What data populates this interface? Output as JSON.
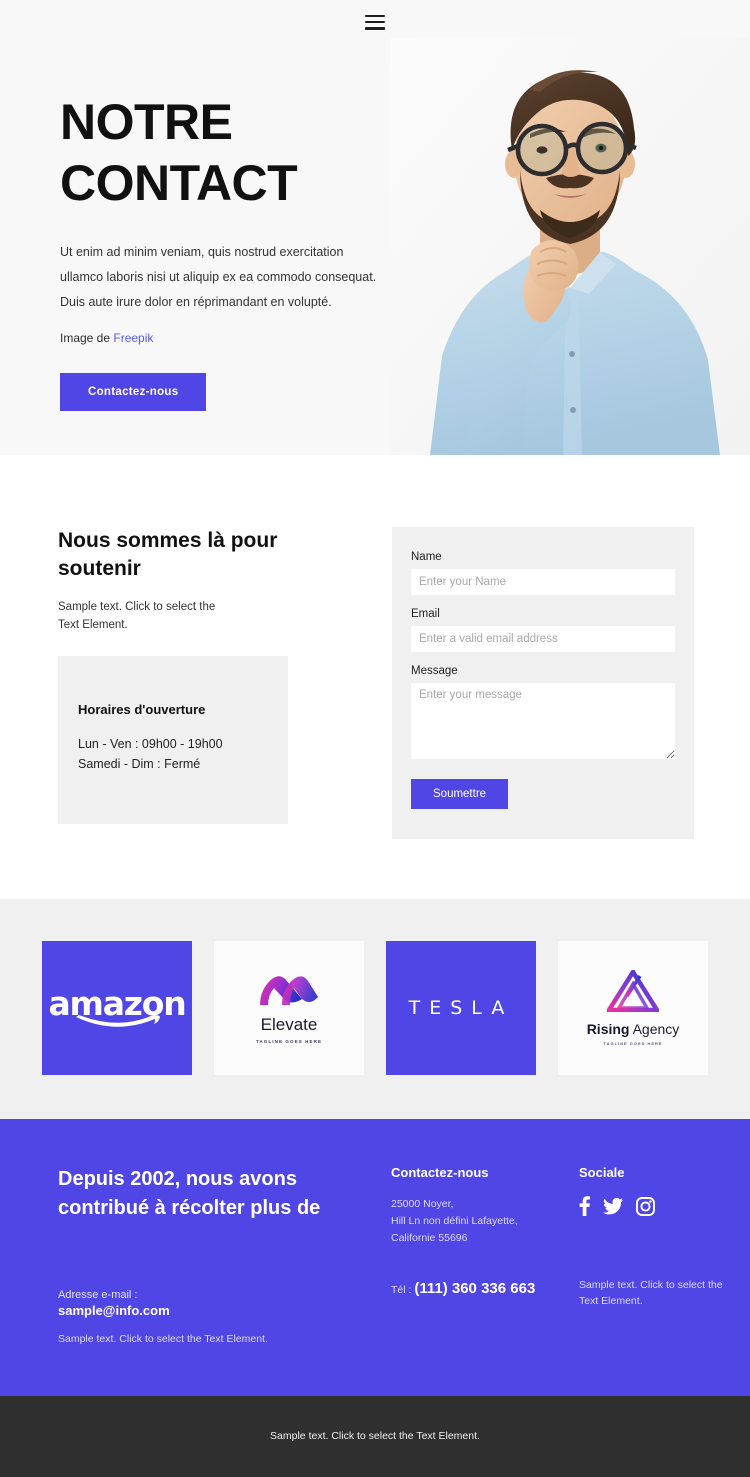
{
  "hero": {
    "menu_icon": "hamburger-menu-icon",
    "title_line1": "NOTRE",
    "title_line2": "CONTACT",
    "paragraph": "Ut enim ad minim veniam, quis nostrud exercitation ullamco laboris nisi ut aliquip ex ea commodo consequat. Duis aute irure dolor en réprimandant en volupté.",
    "credit_prefix": "Image de ",
    "credit_link": "Freepik",
    "cta_label": "Contactez-nous",
    "photo_alt": "bearded-man-with-glasses-thinking"
  },
  "support": {
    "title": "Nous sommes là pour soutenir",
    "subtitle": "Sample text. Click to select the Text Element.",
    "hours_title": "Horaires d'ouverture",
    "hours_weekday": "Lun - Ven : 09h00 - 19h00",
    "hours_weekend": "Samedi - Dim : Fermé"
  },
  "form": {
    "name_label": "Name",
    "name_placeholder": "Enter your Name",
    "name_value": "",
    "email_label": "Email",
    "email_placeholder": "Enter a valid email address",
    "email_value": "",
    "message_label": "Message",
    "message_placeholder": "Enter your message",
    "message_value": "",
    "submit_label": "Soumettre"
  },
  "logos": [
    {
      "name": "amazon",
      "style": "purple",
      "wordmark": "amazon"
    },
    {
      "name": "elevate",
      "style": "white",
      "wordmark": "Elevate",
      "tagline": "TAGLINE GOES HERE"
    },
    {
      "name": "tesla",
      "style": "purple",
      "wordmark": "TESLA"
    },
    {
      "name": "rising-agency",
      "style": "white",
      "wordmark_bold": "Rising",
      "wordmark_light": " Agency",
      "tagline": "TAGLINE GOES HERE"
    }
  ],
  "footer": {
    "heading": "Depuis 2002, nous avons contribué à récolter plus de",
    "email_label": "Adresse e-mail :",
    "email_value": "sample@info.com",
    "note": "Sample text. Click to select the Text Element.",
    "contact_title": "Contactez-nous",
    "address_line1": "25000 Noyer,",
    "address_line2": "Hill Ln non défini Lafayette,",
    "address_line3": "Californie 55696",
    "tel_label": "Tél : ",
    "tel_value": "(111) 360 336 663",
    "social_title": "Sociale",
    "social_icons": [
      "facebook-icon",
      "twitter-icon",
      "instagram-icon"
    ],
    "social_note": "Sample text. Click to select the Text Element."
  },
  "bottombar": {
    "text": "Sample text. Click to select the Text Element."
  },
  "colors": {
    "accent": "#4f46e5",
    "hero_bg": "#f8f8f8",
    "section_grey": "#f0f0f0",
    "footer_purple": "#4f46e5",
    "bottombar_dark": "#2f2f2f",
    "link": "#5a5ae8"
  }
}
